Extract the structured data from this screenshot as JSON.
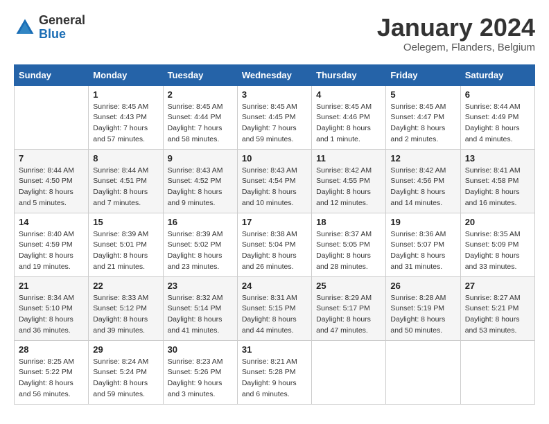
{
  "header": {
    "logo_general": "General",
    "logo_blue": "Blue",
    "month_title": "January 2024",
    "location": "Oelegem, Flanders, Belgium"
  },
  "days_header": [
    "Sunday",
    "Monday",
    "Tuesday",
    "Wednesday",
    "Thursday",
    "Friday",
    "Saturday"
  ],
  "weeks": [
    [
      {
        "day": "",
        "sunrise": "",
        "sunset": "",
        "daylight": ""
      },
      {
        "day": "1",
        "sunrise": "Sunrise: 8:45 AM",
        "sunset": "Sunset: 4:43 PM",
        "daylight": "Daylight: 7 hours and 57 minutes."
      },
      {
        "day": "2",
        "sunrise": "Sunrise: 8:45 AM",
        "sunset": "Sunset: 4:44 PM",
        "daylight": "Daylight: 7 hours and 58 minutes."
      },
      {
        "day": "3",
        "sunrise": "Sunrise: 8:45 AM",
        "sunset": "Sunset: 4:45 PM",
        "daylight": "Daylight: 7 hours and 59 minutes."
      },
      {
        "day": "4",
        "sunrise": "Sunrise: 8:45 AM",
        "sunset": "Sunset: 4:46 PM",
        "daylight": "Daylight: 8 hours and 1 minute."
      },
      {
        "day": "5",
        "sunrise": "Sunrise: 8:45 AM",
        "sunset": "Sunset: 4:47 PM",
        "daylight": "Daylight: 8 hours and 2 minutes."
      },
      {
        "day": "6",
        "sunrise": "Sunrise: 8:44 AM",
        "sunset": "Sunset: 4:49 PM",
        "daylight": "Daylight: 8 hours and 4 minutes."
      }
    ],
    [
      {
        "day": "7",
        "sunrise": "Sunrise: 8:44 AM",
        "sunset": "Sunset: 4:50 PM",
        "daylight": "Daylight: 8 hours and 5 minutes."
      },
      {
        "day": "8",
        "sunrise": "Sunrise: 8:44 AM",
        "sunset": "Sunset: 4:51 PM",
        "daylight": "Daylight: 8 hours and 7 minutes."
      },
      {
        "day": "9",
        "sunrise": "Sunrise: 8:43 AM",
        "sunset": "Sunset: 4:52 PM",
        "daylight": "Daylight: 8 hours and 9 minutes."
      },
      {
        "day": "10",
        "sunrise": "Sunrise: 8:43 AM",
        "sunset": "Sunset: 4:54 PM",
        "daylight": "Daylight: 8 hours and 10 minutes."
      },
      {
        "day": "11",
        "sunrise": "Sunrise: 8:42 AM",
        "sunset": "Sunset: 4:55 PM",
        "daylight": "Daylight: 8 hours and 12 minutes."
      },
      {
        "day": "12",
        "sunrise": "Sunrise: 8:42 AM",
        "sunset": "Sunset: 4:56 PM",
        "daylight": "Daylight: 8 hours and 14 minutes."
      },
      {
        "day": "13",
        "sunrise": "Sunrise: 8:41 AM",
        "sunset": "Sunset: 4:58 PM",
        "daylight": "Daylight: 8 hours and 16 minutes."
      }
    ],
    [
      {
        "day": "14",
        "sunrise": "Sunrise: 8:40 AM",
        "sunset": "Sunset: 4:59 PM",
        "daylight": "Daylight: 8 hours and 19 minutes."
      },
      {
        "day": "15",
        "sunrise": "Sunrise: 8:39 AM",
        "sunset": "Sunset: 5:01 PM",
        "daylight": "Daylight: 8 hours and 21 minutes."
      },
      {
        "day": "16",
        "sunrise": "Sunrise: 8:39 AM",
        "sunset": "Sunset: 5:02 PM",
        "daylight": "Daylight: 8 hours and 23 minutes."
      },
      {
        "day": "17",
        "sunrise": "Sunrise: 8:38 AM",
        "sunset": "Sunset: 5:04 PM",
        "daylight": "Daylight: 8 hours and 26 minutes."
      },
      {
        "day": "18",
        "sunrise": "Sunrise: 8:37 AM",
        "sunset": "Sunset: 5:05 PM",
        "daylight": "Daylight: 8 hours and 28 minutes."
      },
      {
        "day": "19",
        "sunrise": "Sunrise: 8:36 AM",
        "sunset": "Sunset: 5:07 PM",
        "daylight": "Daylight: 8 hours and 31 minutes."
      },
      {
        "day": "20",
        "sunrise": "Sunrise: 8:35 AM",
        "sunset": "Sunset: 5:09 PM",
        "daylight": "Daylight: 8 hours and 33 minutes."
      }
    ],
    [
      {
        "day": "21",
        "sunrise": "Sunrise: 8:34 AM",
        "sunset": "Sunset: 5:10 PM",
        "daylight": "Daylight: 8 hours and 36 minutes."
      },
      {
        "day": "22",
        "sunrise": "Sunrise: 8:33 AM",
        "sunset": "Sunset: 5:12 PM",
        "daylight": "Daylight: 8 hours and 39 minutes."
      },
      {
        "day": "23",
        "sunrise": "Sunrise: 8:32 AM",
        "sunset": "Sunset: 5:14 PM",
        "daylight": "Daylight: 8 hours and 41 minutes."
      },
      {
        "day": "24",
        "sunrise": "Sunrise: 8:31 AM",
        "sunset": "Sunset: 5:15 PM",
        "daylight": "Daylight: 8 hours and 44 minutes."
      },
      {
        "day": "25",
        "sunrise": "Sunrise: 8:29 AM",
        "sunset": "Sunset: 5:17 PM",
        "daylight": "Daylight: 8 hours and 47 minutes."
      },
      {
        "day": "26",
        "sunrise": "Sunrise: 8:28 AM",
        "sunset": "Sunset: 5:19 PM",
        "daylight": "Daylight: 8 hours and 50 minutes."
      },
      {
        "day": "27",
        "sunrise": "Sunrise: 8:27 AM",
        "sunset": "Sunset: 5:21 PM",
        "daylight": "Daylight: 8 hours and 53 minutes."
      }
    ],
    [
      {
        "day": "28",
        "sunrise": "Sunrise: 8:25 AM",
        "sunset": "Sunset: 5:22 PM",
        "daylight": "Daylight: 8 hours and 56 minutes."
      },
      {
        "day": "29",
        "sunrise": "Sunrise: 8:24 AM",
        "sunset": "Sunset: 5:24 PM",
        "daylight": "Daylight: 8 hours and 59 minutes."
      },
      {
        "day": "30",
        "sunrise": "Sunrise: 8:23 AM",
        "sunset": "Sunset: 5:26 PM",
        "daylight": "Daylight: 9 hours and 3 minutes."
      },
      {
        "day": "31",
        "sunrise": "Sunrise: 8:21 AM",
        "sunset": "Sunset: 5:28 PM",
        "daylight": "Daylight: 9 hours and 6 minutes."
      },
      {
        "day": "",
        "sunrise": "",
        "sunset": "",
        "daylight": ""
      },
      {
        "day": "",
        "sunrise": "",
        "sunset": "",
        "daylight": ""
      },
      {
        "day": "",
        "sunrise": "",
        "sunset": "",
        "daylight": ""
      }
    ]
  ]
}
